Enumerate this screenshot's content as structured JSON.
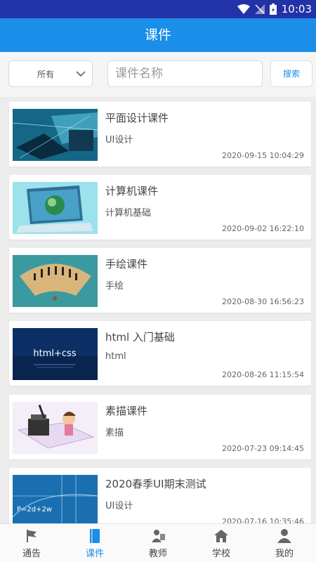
{
  "status_bar": {
    "time": "10:03"
  },
  "header": {
    "title": "课件"
  },
  "filter": {
    "selected": "所有",
    "search_placeholder": "课件名称",
    "search_button": "搜索"
  },
  "courses": [
    {
      "title": "平面设计课件",
      "category": "UI设计",
      "date": "2020-09-15 10:04:29"
    },
    {
      "title": "计算机课件",
      "category": "计算机基础",
      "date": "2020-09-02 16:22:10"
    },
    {
      "title": "手绘课件",
      "category": "手绘",
      "date": "2020-08-30 16:56:23"
    },
    {
      "title": "html 入门基础",
      "category": "html",
      "date": "2020-08-26 11:15:54",
      "thumb_text": "html+css"
    },
    {
      "title": "素描课件",
      "category": "素描",
      "date": "2020-07-23 09:14:45"
    },
    {
      "title": "2020春季UI期末测试",
      "category": "UI设计",
      "date": "2020-07-16 10:35:46",
      "thumb_text": "P=2d+2w"
    }
  ],
  "bottom_nav": [
    {
      "label": "通告",
      "icon": "flag-icon",
      "active": false
    },
    {
      "label": "课件",
      "icon": "book-icon",
      "active": true
    },
    {
      "label": "教师",
      "icon": "teacher-icon",
      "active": false
    },
    {
      "label": "学校",
      "icon": "school-icon",
      "active": false
    },
    {
      "label": "我的",
      "icon": "user-icon",
      "active": false
    }
  ],
  "colors": {
    "accent": "#1a8ee8",
    "status_bar": "#2233a8",
    "inactive_nav": "#444444"
  }
}
